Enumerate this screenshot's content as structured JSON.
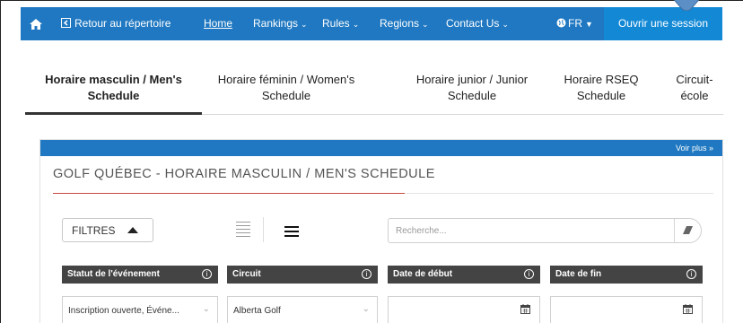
{
  "nav": {
    "home_icon": "home-icon",
    "retour_label": "Retour au répertoire",
    "home_label": "Home",
    "rankings_label": "Rankings",
    "rules_label": "Rules",
    "regions_label": "Regions",
    "contact_label": "Contact Us",
    "lang_label": "FR",
    "session_label": "Ouvrir une session"
  },
  "tabs": [
    {
      "label_line1": "Horaire masculin / Men's",
      "label_line2": "Schedule"
    },
    {
      "label_line1": "Horaire féminin / Women's",
      "label_line2": "Schedule"
    },
    {
      "label_line1": "Horaire junior / Junior",
      "label_line2": "Schedule"
    },
    {
      "label_line1": "Horaire RSEQ",
      "label_line2": "Schedule"
    },
    {
      "label_line1": "Circuit-",
      "label_line2": "école"
    }
  ],
  "panel": {
    "voir_plus": "Voir plus »",
    "title": "GOLF QUÉBEC - HORAIRE MASCULIN / MEN'S SCHEDULE"
  },
  "filters": {
    "label": "FILTRES",
    "search_placeholder": "Recherche..."
  },
  "columns": [
    {
      "label": "Statut de l'événement"
    },
    {
      "label": "Circuit"
    },
    {
      "label": "Date de début"
    },
    {
      "label": "Date de fin"
    }
  ],
  "values": {
    "statut": "Inscription ouverte, Événe...",
    "circuit": "Alberta Golf",
    "date_debut": "",
    "date_fin": ""
  },
  "colors": {
    "nav_bg": "#1f78c1",
    "accent_line": "#c9463d",
    "header_bg": "#444444"
  }
}
